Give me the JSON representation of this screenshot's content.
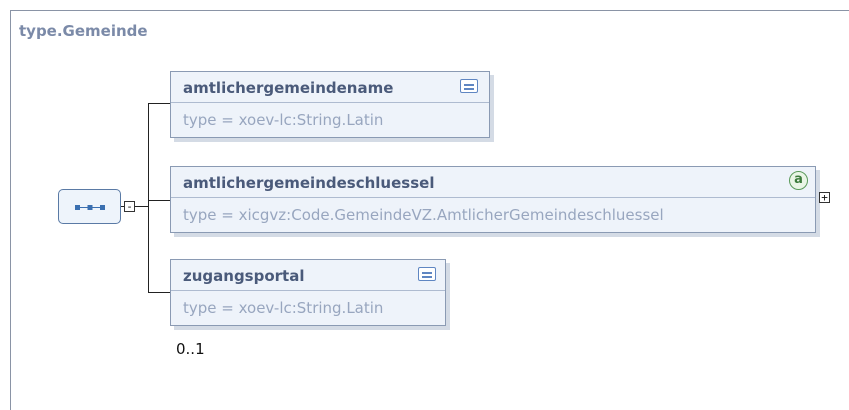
{
  "complex_type": {
    "name": "type.Gemeinde"
  },
  "sequence": {
    "connector_icon": "sequence-dots-icon",
    "collapse_symbol": "-"
  },
  "elements": [
    {
      "name": "amtlichergemeindename",
      "type": "type = xoev-lc:String.Latin",
      "icon": "documentation-icon",
      "occurrence": ""
    },
    {
      "name": "amtlichergemeindeschluessel",
      "type": "type = xicgvz:Code.GemeindeVZ.AmtlicherGemeindeschluessel",
      "icon": "attribute-icon",
      "attribute_badge": "a",
      "expand_symbol": "+",
      "occurrence": ""
    },
    {
      "name": "zugangsportal",
      "type": "type = xoev-lc:String.Latin",
      "icon": "documentation-icon",
      "occurrence": "0..1"
    }
  ],
  "colors": {
    "box_fill": "#eef3fa",
    "box_border": "#8a9ab3",
    "name_text": "#4a5a7a",
    "type_text": "#98a6bf",
    "title_text": "#7b8aa8"
  }
}
